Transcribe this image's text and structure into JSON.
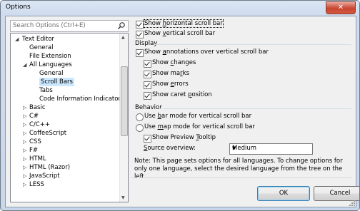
{
  "window": {
    "title": "Options",
    "close_glyph": "✕"
  },
  "search": {
    "placeholder": "Search Options (Ctrl+E)",
    "icon": "search-icon"
  },
  "tree": {
    "items": [
      {
        "label": "Text Editor",
        "arrow": "◢"
      },
      {
        "label": "General"
      },
      {
        "label": "File Extension"
      },
      {
        "label": "All Languages",
        "arrow": "◢"
      },
      {
        "label": "General"
      },
      {
        "label": "Scroll Bars"
      },
      {
        "label": "Tabs"
      },
      {
        "label": "Code Information Indicators"
      },
      {
        "label": "Basic",
        "arrow": "▷"
      },
      {
        "label": "C#",
        "arrow": "▷"
      },
      {
        "label": "C/C++",
        "arrow": "▷"
      },
      {
        "label": "CoffeeScript",
        "arrow": "▷"
      },
      {
        "label": "CSS",
        "arrow": "▷"
      },
      {
        "label": "F#",
        "arrow": "▷"
      },
      {
        "label": "HTML",
        "arrow": "▷"
      },
      {
        "label": "HTML (Razor)",
        "arrow": "▷"
      },
      {
        "label": "JavaScript",
        "arrow": "▷"
      },
      {
        "label": "LESS",
        "arrow": "▷"
      }
    ],
    "selected": "Scroll Bars",
    "scroll_up": "▲",
    "scroll_down": "▼"
  },
  "options": {
    "show_horizontal": {
      "pre": "Show ",
      "u": "h",
      "post": "orizontal scroll bar",
      "checked": true
    },
    "show_vertical": {
      "pre": "Show ",
      "u": "v",
      "post": "ertical scroll bar",
      "checked": true
    },
    "display_group": "Display",
    "show_annotations": {
      "pre": "Show ",
      "u": "a",
      "post": "nnotations over vertical scroll bar",
      "checked": true
    },
    "show_changes": {
      "pre": "Show ",
      "u": "c",
      "post": "hanges",
      "checked": true
    },
    "show_marks": {
      "pre": "Show ma",
      "u": "r",
      "post": "ks",
      "checked": true
    },
    "show_errors": {
      "pre": "Show ",
      "u": "e",
      "post": "rrors",
      "checked": true
    },
    "show_caret": {
      "pre": "Show caret ",
      "u": "p",
      "post": "osition",
      "checked": true
    },
    "behavior_group": "Behavior",
    "bar_mode": {
      "pre": "Use ",
      "u": "b",
      "post": "ar mode for vertical scroll bar",
      "selected": false
    },
    "map_mode": {
      "pre": "Use ",
      "u": "m",
      "post": "ap mode for vertical scroll bar",
      "selected": false
    },
    "show_tooltip": {
      "pre": "Show Preview ",
      "u": "T",
      "post": "ooltip",
      "checked": true
    },
    "source_overview": {
      "pre": "",
      "u": "S",
      "post": "ource overview:",
      "value": "Medium",
      "dropdown": "▼"
    }
  },
  "note": "Note: This page sets options for all languages. To change options for only one language, select the desired language from the tree on the left.",
  "buttons": {
    "ok": "OK",
    "cancel": "Cancel"
  }
}
